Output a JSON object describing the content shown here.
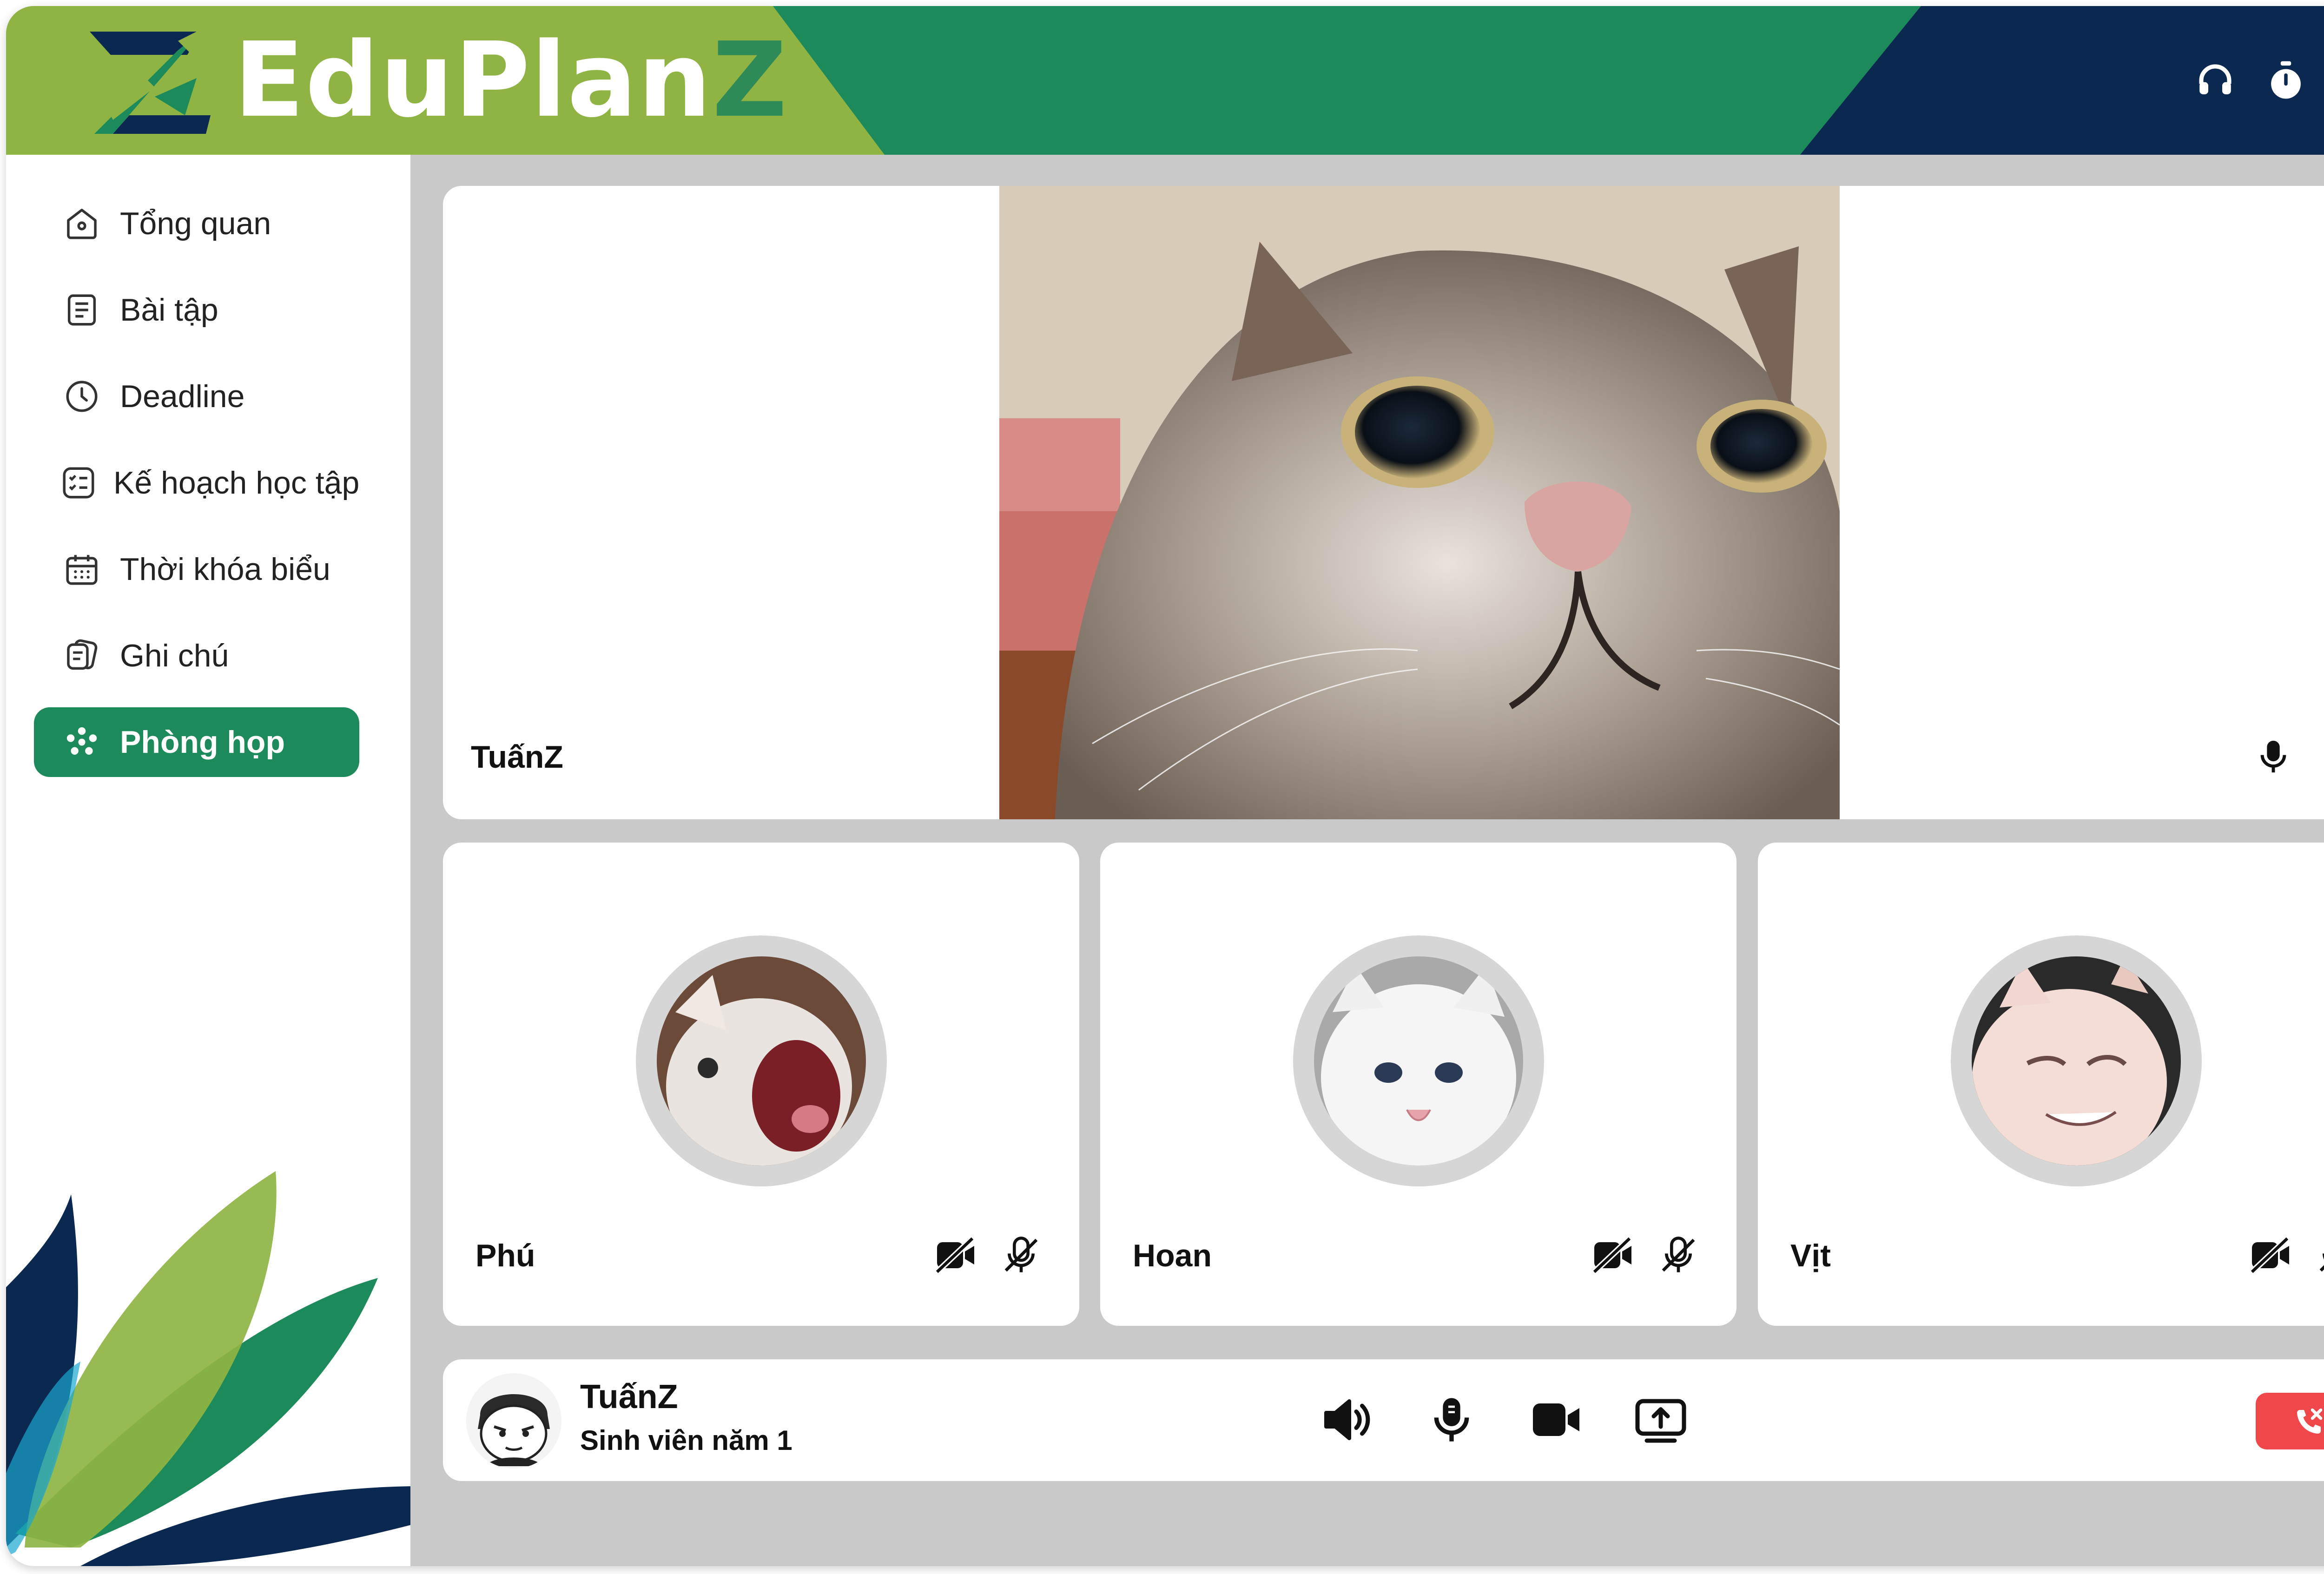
{
  "header": {
    "brand_main": "EduPlan",
    "brand_suffix": "Z",
    "icons": [
      "headphones-icon",
      "timer-icon",
      "gear-icon"
    ],
    "colors": {
      "lime": "#8fb443",
      "green": "#1c8a5a",
      "navy": "#0b2850"
    }
  },
  "sidebar": {
    "items": [
      {
        "label": "Tổng quan",
        "icon": "home-icon"
      },
      {
        "label": "Bài tập",
        "icon": "document-icon"
      },
      {
        "label": "Deadline",
        "icon": "clock-icon"
      },
      {
        "label": "Kế hoạch học tập",
        "icon": "checklist-icon"
      },
      {
        "label": "Thời khóa biểu",
        "icon": "calendar-icon"
      },
      {
        "label": "Ghi chú",
        "icon": "notes-icon"
      },
      {
        "label": "Phòng họp",
        "icon": "meeting-icon",
        "active": true
      }
    ]
  },
  "meeting": {
    "main_speaker": {
      "name": "TuấnZ",
      "mic": "on",
      "camera": "on"
    },
    "participants": [
      {
        "name": "Phú",
        "camera": "off",
        "mic": "off"
      },
      {
        "name": "Hoan",
        "camera": "off",
        "mic": "off"
      },
      {
        "name": "Vịt",
        "camera": "off",
        "mic": "off"
      }
    ],
    "me": {
      "name": "TuấnZ",
      "role": "Sinh viên năm 1"
    },
    "controls": [
      "speaker-icon",
      "microphone-icon",
      "camera-icon",
      "share-screen-icon"
    ],
    "hangup_color": "#f0474b"
  }
}
